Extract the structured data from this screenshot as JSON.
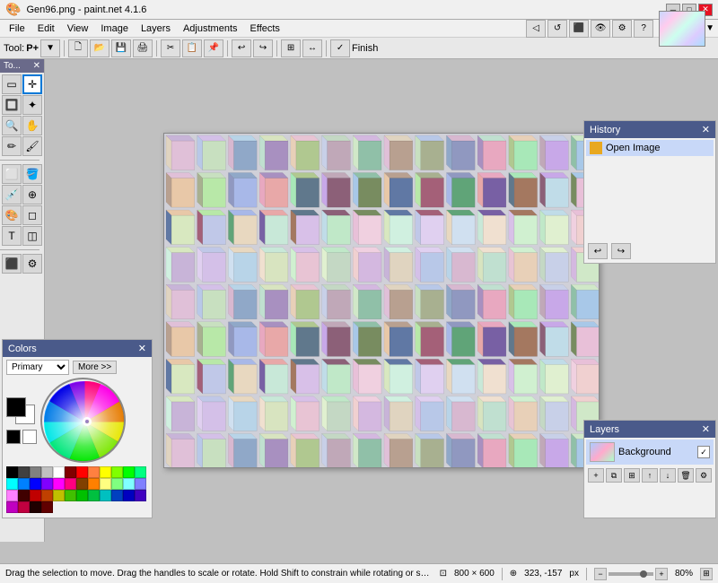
{
  "title": "Gen96.png - paint.net 4.1.6",
  "titleControls": {
    "minimize": "─",
    "maximize": "□",
    "close": "✕"
  },
  "menuItems": [
    "File",
    "Edit",
    "View",
    "Image",
    "Layers",
    "Adjustments",
    "Effects"
  ],
  "toolbar": {
    "finishLabel": "Finish",
    "toolLabel": "Tool:",
    "toolValue": "P+"
  },
  "toolsPanel": {
    "title": "To...",
    "closeLabel": "✕"
  },
  "historyPanel": {
    "title": "History",
    "closeLabel": "✕",
    "items": [
      {
        "label": "Open Image",
        "icon": "folder"
      }
    ],
    "undoLabel": "↩",
    "redoLabel": "↪"
  },
  "layersPanel": {
    "title": "Layers",
    "closeLabel": "✕",
    "layers": [
      {
        "name": "Background",
        "checked": true
      }
    ]
  },
  "colorsPanel": {
    "title": "Colors",
    "closeLabel": "✕",
    "primaryLabel": "Primary",
    "moreLabel": "More >>",
    "colorDotX": "48%",
    "colorDotY": "50%"
  },
  "statusBar": {
    "message": "Drag the selection to move. Drag the handles to scale or rotate. Hold Shift to constrain while rotating or scaling.",
    "dimensions": "800 × 600",
    "coordinates": "323, -157",
    "pxLabel": "px",
    "zoom": "80%",
    "coordIcon": "⊕",
    "sizeIcon": "⊡"
  },
  "canvas": {
    "imageDescription": "Colorful 3D cube grid"
  },
  "paletteColors": [
    "#000000",
    "#404040",
    "#808080",
    "#c0c0c0",
    "#ffffff",
    "#800000",
    "#ff0000",
    "#ff8040",
    "#ffff00",
    "#80ff00",
    "#00ff00",
    "#00ff80",
    "#00ffff",
    "#0080ff",
    "#0000ff",
    "#8000ff",
    "#ff00ff",
    "#ff0080",
    "#804000",
    "#ff8000",
    "#ffff80",
    "#80ff80",
    "#80ffff",
    "#8080ff",
    "#ff80ff",
    "#400000",
    "#c00000",
    "#c04000",
    "#c0c000",
    "#40c000",
    "#00c000",
    "#00c040",
    "#00c0c0",
    "#0040c0",
    "#0000c0",
    "#4000c0",
    "#c000c0",
    "#c00040",
    "#200000",
    "#600000"
  ]
}
